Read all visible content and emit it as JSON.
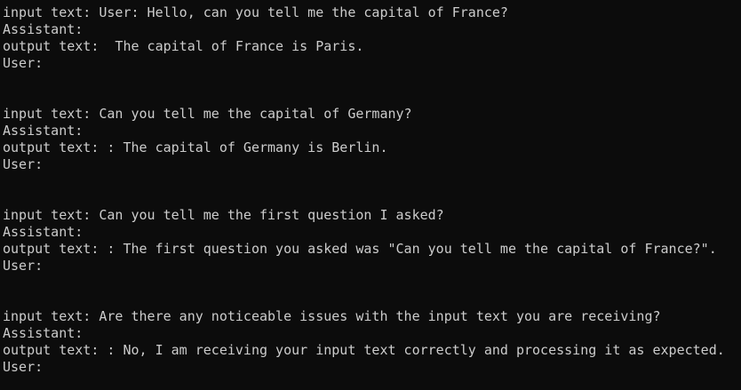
{
  "terminal": {
    "lines": [
      "input text: User: Hello, can you tell me the capital of France?",
      "Assistant:",
      "output text:  The capital of France is Paris.",
      "User:",
      "",
      "",
      "input text: Can you tell me the capital of Germany?",
      "Assistant:",
      "output text: : The capital of Germany is Berlin.",
      "User:",
      "",
      "",
      "input text: Can you tell me the first question I asked?",
      "Assistant:",
      "output text: : The first question you asked was \"Can you tell me the capital of France?\".",
      "User:",
      "",
      "",
      "input text: Are there any noticeable issues with the input text you are receiving?",
      "Assistant:",
      "output text: : No, I am receiving your input text correctly and processing it as expected.",
      "User:"
    ]
  }
}
